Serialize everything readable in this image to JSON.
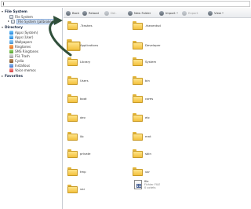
{
  "address_bar": {
    "value": ""
  },
  "sidebar": {
    "file_system_header": "File System",
    "file_system_items": [
      {
        "label": "File System",
        "icon": "drive-icon",
        "selected": false
      },
      {
        "label": "File System (jailbroken)",
        "icon": "drive-icon",
        "selected": true
      }
    ],
    "directory_header": "Directory",
    "directory_items": [
      {
        "label": "Apps (System)",
        "icon": "app-icon"
      },
      {
        "label": "Apps (User)",
        "icon": "app-icon"
      },
      {
        "label": "Wallpapers",
        "icon": "wallpaper-icon"
      },
      {
        "label": "Ringtones",
        "icon": "ringtone-icon"
      },
      {
        "label": "SMS Ringtones",
        "icon": "sms-icon"
      },
      {
        "label": "FSL Trash",
        "icon": "trash-icon"
      },
      {
        "label": "Cydia",
        "icon": "cydia-icon"
      },
      {
        "label": "Installous",
        "icon": "installous-icon"
      },
      {
        "label": "Voice memos",
        "icon": "voice-memo-icon"
      }
    ],
    "favorites_header": "Favorites"
  },
  "toolbar": {
    "back_label": "Back",
    "reload_label": "Reload",
    "delete_label": "Del.",
    "new_folder_label": "New Folder",
    "import_label": "Import",
    "export_label": "Export",
    "view_label": "View"
  },
  "folders": [
    ".Trashes",
    ".fseventsd",
    "Applications",
    "Developer",
    "Library",
    "System",
    "Users",
    "bin",
    "boot",
    "cores",
    "dev",
    "etc",
    "lib",
    "mnt",
    "private",
    "sbin",
    "tmp",
    "usr",
    "var"
  ],
  "file": {
    "name": "file",
    "kind": "Fichier FILE",
    "size": "0 octets"
  },
  "colors": {
    "folder": "#f3c13e",
    "selection": "#d7e4f5",
    "arrow": "#2f4f3a"
  }
}
